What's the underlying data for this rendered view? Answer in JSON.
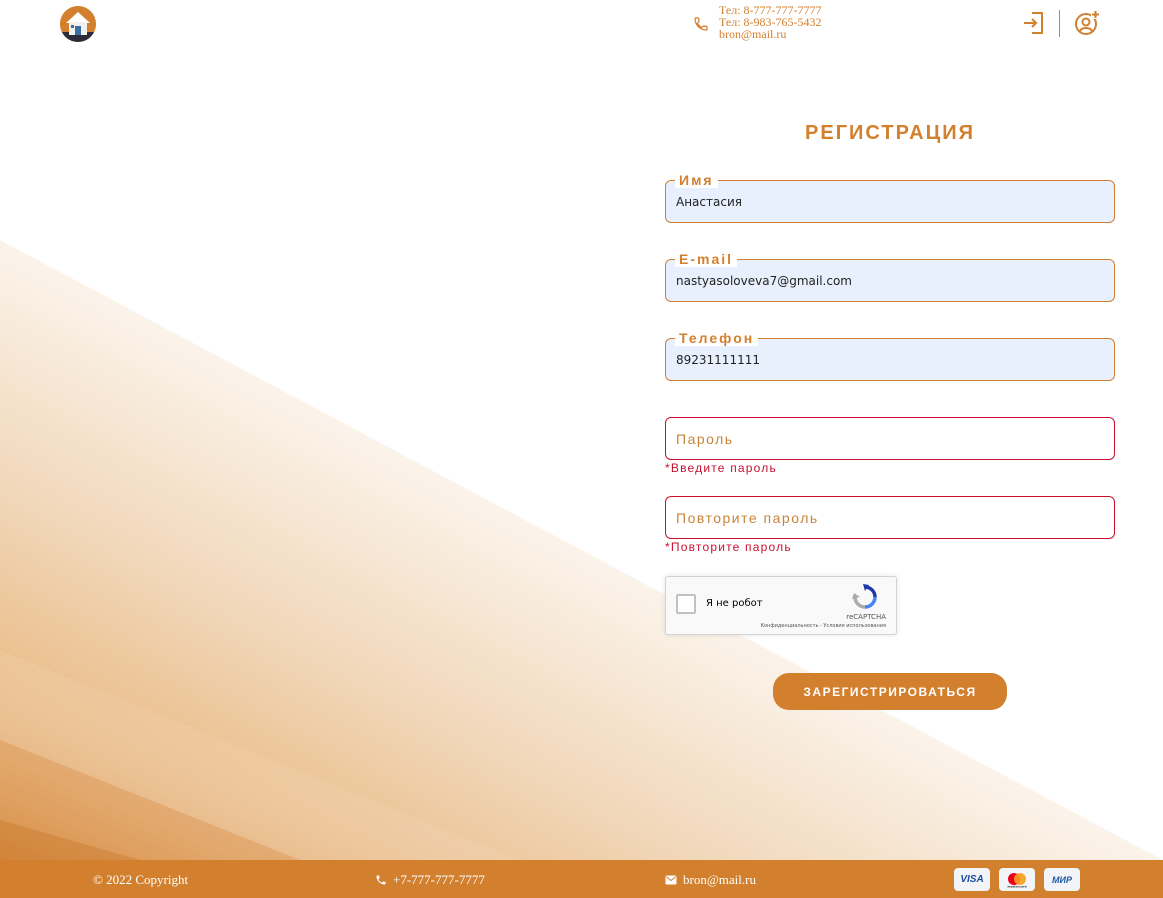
{
  "header": {
    "phone_lines": [
      "Тел: 8-777-777-7777",
      "Тел: 8-983-765-5432",
      "bron@mail.ru"
    ]
  },
  "form": {
    "title": "РЕГИСТРАЦИЯ",
    "name_label": "Имя",
    "name_value": "Анастасия",
    "email_label": "E-mail",
    "email_value": "nastyasoloveva7@gmail.com",
    "phone_label": "Телефон",
    "phone_value": "89231111111",
    "password_placeholder": "Пароль",
    "password_error": "*Введите пароль",
    "password_repeat_placeholder": "Повторите пароль",
    "password_repeat_error": "*Повторите пароль",
    "submit_label": "ЗАРЕГИСТРИРОВАТЬСЯ"
  },
  "captcha": {
    "label": "Я не робот",
    "brand": "reCAPTCHA",
    "legal": "Конфиденциальность - Условия использования"
  },
  "footer": {
    "copyright": "© 2022 Copyright",
    "phone": "+7-777-777-7777",
    "email": "bron@mail.ru",
    "payments": [
      "VISA",
      "mastercard",
      "МИР"
    ]
  },
  "colors": {
    "accent": "#d27f2e",
    "error": "#c8102e",
    "autofill": "#e8f0fe"
  },
  "icons": [
    "home-logo-icon",
    "phone-icon",
    "login-icon",
    "user-add-icon",
    "recaptcha-icon",
    "mail-icon"
  ]
}
